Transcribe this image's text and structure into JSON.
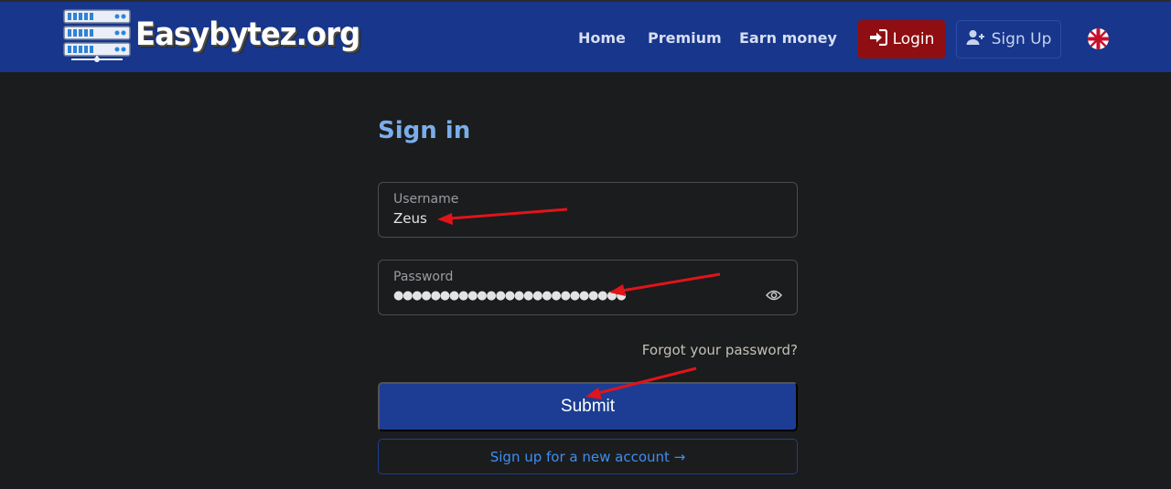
{
  "header": {
    "brand": "Easybytez.org",
    "nav": [
      {
        "label": "Home"
      },
      {
        "label": "Premium"
      },
      {
        "label": "Earn money"
      }
    ],
    "login_label": "Login",
    "signup_label": "Sign Up",
    "language_icon": "uk-flag-icon"
  },
  "form": {
    "title": "Sign in",
    "username_label": "Username",
    "username_value": "Zeus",
    "password_label": "Password",
    "password_value": "●●●●●●●●●●●●●●●●●●●●●●●●●",
    "forgot_label": "Forgot your password?",
    "submit_label": "Submit",
    "signup_link_label": "Sign up for a new account →"
  },
  "colors": {
    "navbar": "#17368c",
    "background": "#1b1c1e",
    "login_button": "#8e0e12",
    "submit_button": "#1c3d93",
    "title": "#7aaeea",
    "link": "#3f8ef0",
    "annotation_arrow": "#e0141a"
  }
}
